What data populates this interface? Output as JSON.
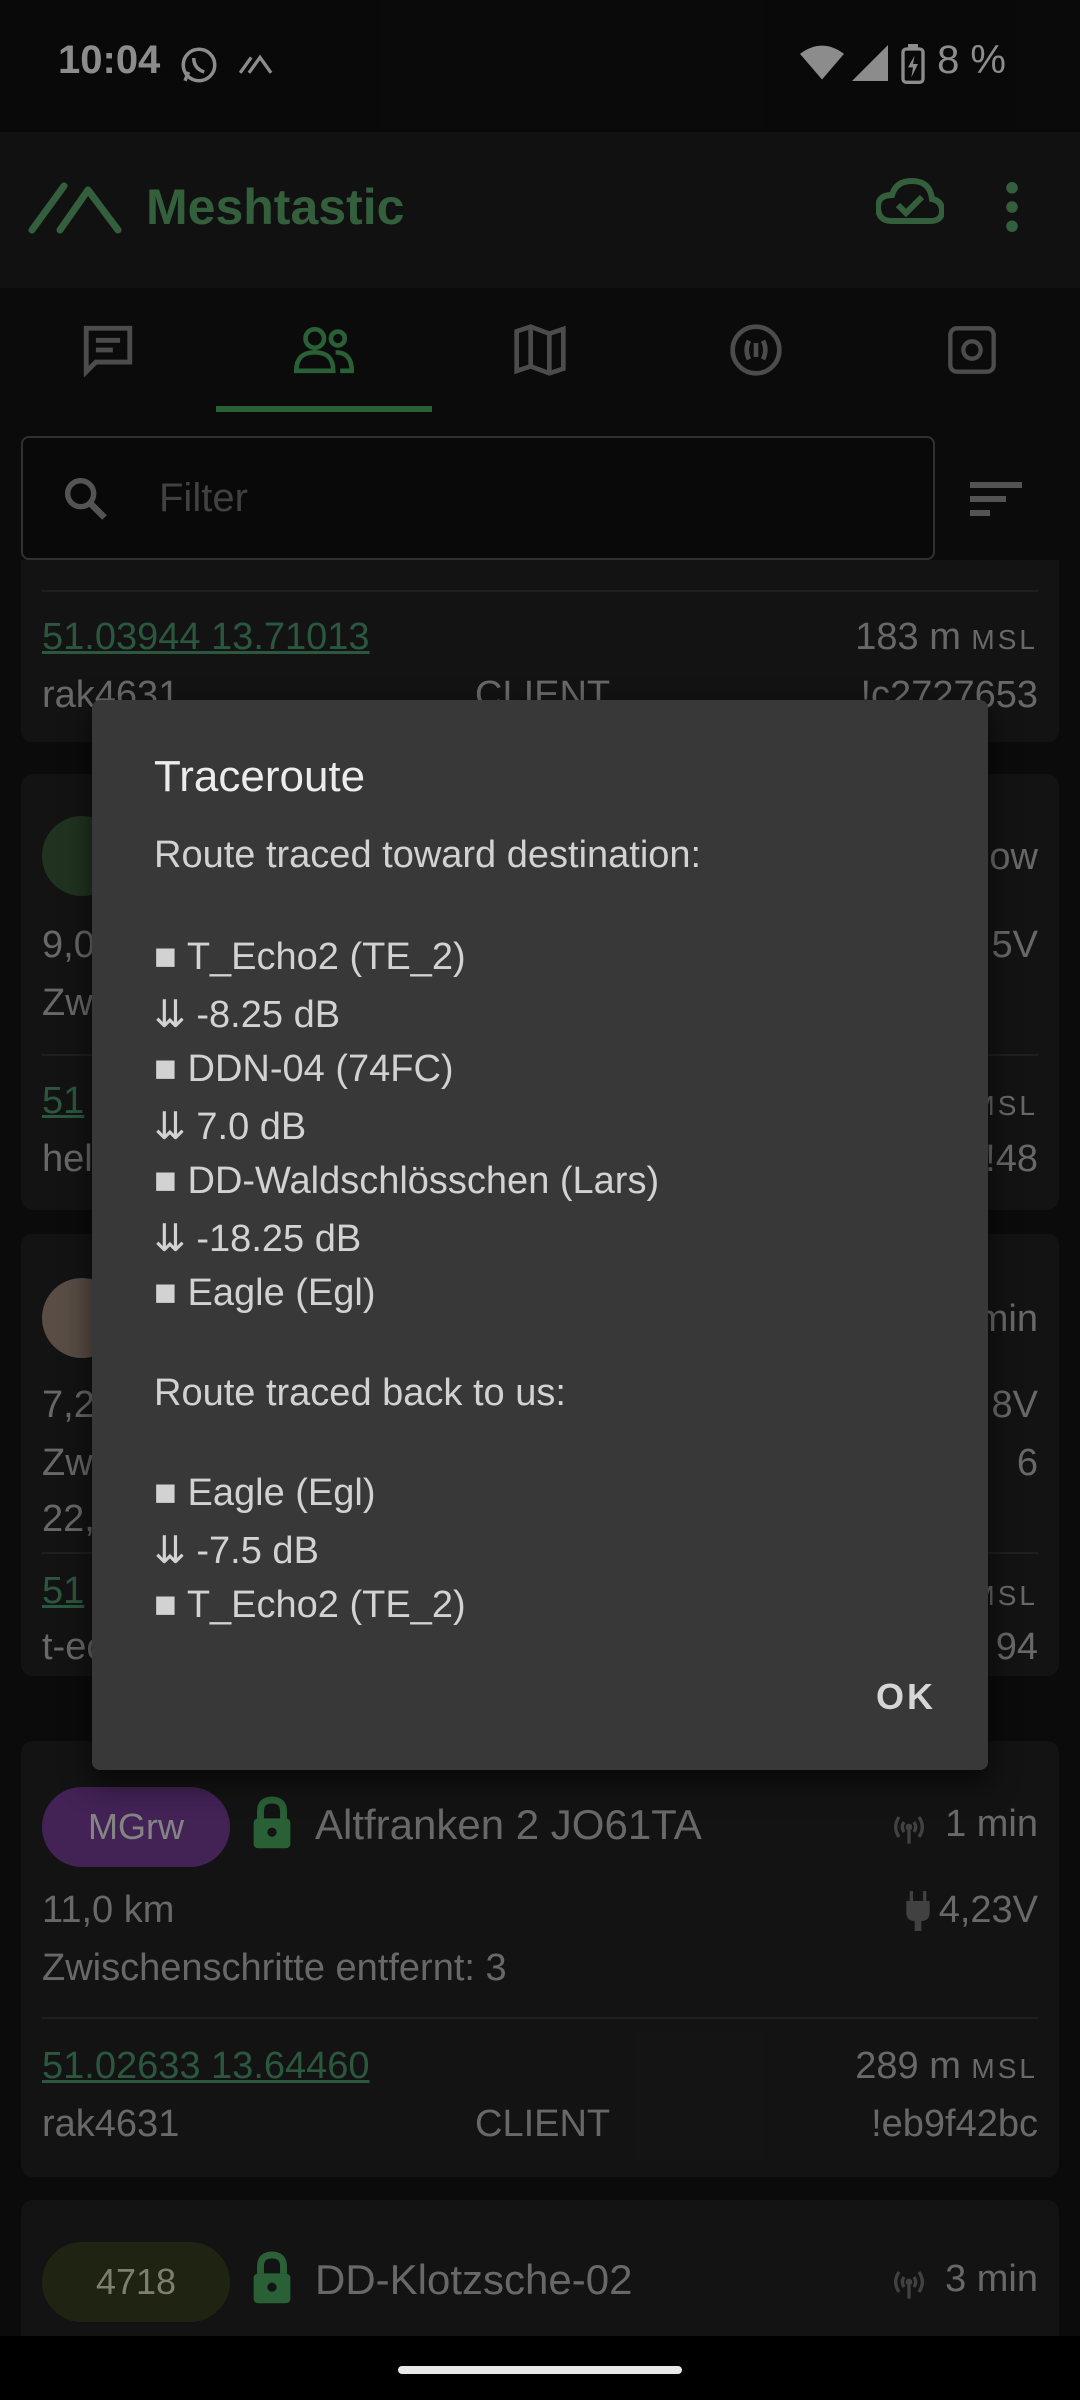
{
  "status_bar": {
    "time": "10:04",
    "battery": "8 %"
  },
  "app_bar": {
    "title": "Meshtastic"
  },
  "tabs": [
    {
      "name": "messages",
      "icon": "chat-icon"
    },
    {
      "name": "nodes",
      "icon": "people-icon"
    },
    {
      "name": "map",
      "icon": "map-icon"
    },
    {
      "name": "channel",
      "icon": "radio-icon"
    },
    {
      "name": "settings",
      "icon": "settings-icon"
    }
  ],
  "filter": {
    "placeholder": "Filter"
  },
  "nodes_visible": [
    {
      "coords": "51.03944 13.71013",
      "altitude": "183 m",
      "alt_unit": "MSL",
      "hw": "rak4631",
      "role": "CLIENT",
      "id": "!c2727653"
    },
    {
      "partial_right_1": "ow",
      "partial_right_2": "5V",
      "left_1": "9,0",
      "left_2": "Zw",
      "coords_partial": "51",
      "alt_unit": "MSL",
      "hw_partial": "hel",
      "id_partial": "!48"
    },
    {
      "partial_right_1": "min",
      "partial_right_2": "8V",
      "partial_right_3": "6",
      "left_1": "7,2",
      "left_2": "Zw",
      "left_3": "22,",
      "coords_partial": "51",
      "alt_unit": "MSL",
      "hw_partial": "t-ec",
      "id_partial": "94"
    },
    {
      "short_name": "MGrw",
      "long_name": "Altfranken 2 JO61TA",
      "last_heard": "1 min",
      "distance": "11,0 km",
      "voltage": "4,23V",
      "hops": "Zwischenschritte entfernt: 3",
      "coords": "51.02633 13.64460",
      "altitude": "289 m",
      "alt_unit": "MSL",
      "hw": "rak4631",
      "role": "CLIENT",
      "id": "!eb9f42bc",
      "chip_color": "#7b3f9c"
    },
    {
      "short_name": "4718",
      "long_name": "DD-Klotzsche-02",
      "last_heard": "3 min",
      "chip_color": "#3a4020"
    }
  ],
  "dialog": {
    "title": "Traceroute",
    "toward_heading": "Route traced toward destination:",
    "toward": [
      "■ T_Echo2 (TE_2)",
      "⇊ -8.25 dB",
      "■ DDN-04 (74FC)",
      "⇊ 7.0 dB",
      "■ DD-Waldschlösschen (Lars)",
      "⇊ -18.25 dB",
      "■ Eagle (Egl)"
    ],
    "back_heading": "Route traced back to us:",
    "back": [
      "■ Eagle (Egl)",
      "⇊ -7.5 dB",
      "■ T_Echo2 (TE_2)"
    ],
    "ok_label": "OK"
  },
  "colors": {
    "accent": "#5fae6f",
    "link": "#4e9f72",
    "lock": "#4caf62"
  }
}
